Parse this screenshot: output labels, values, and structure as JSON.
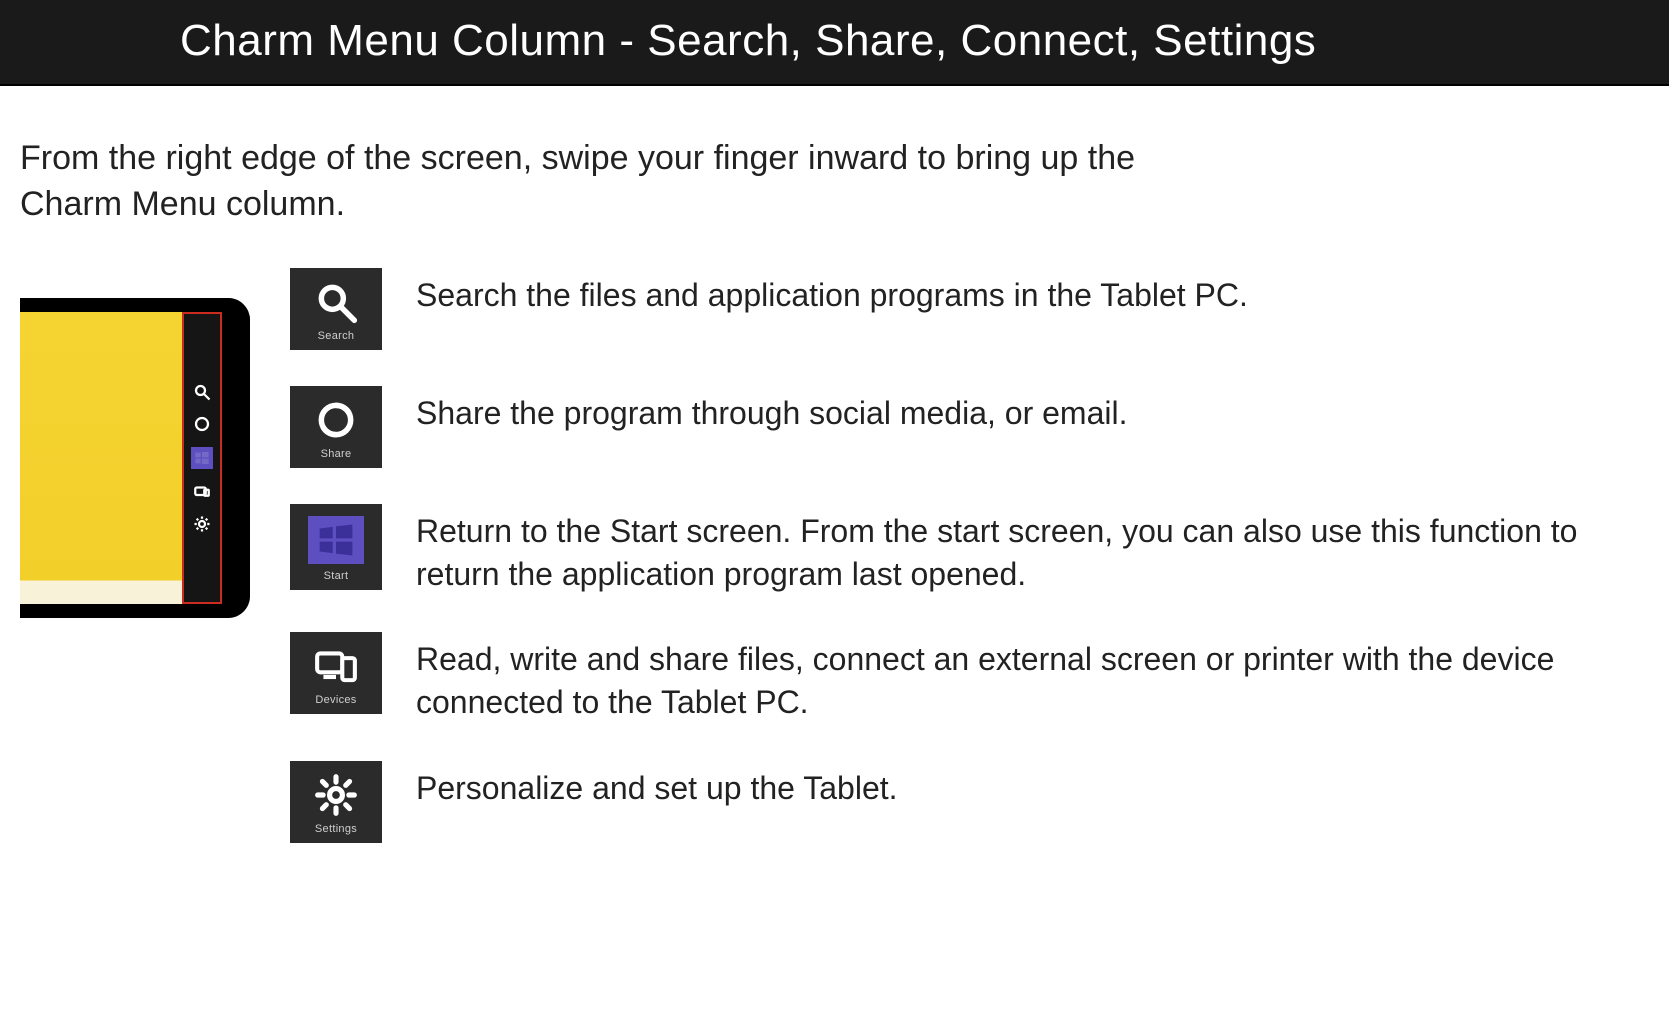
{
  "header": {
    "title": "Charm Menu Column - Search, Share, Connect, Settings"
  },
  "intro": "From the right edge of the screen, swipe your finger inward to bring up the Charm Menu column.",
  "charms": [
    {
      "icon": "search",
      "label": "Search",
      "description": "Search the files and application programs in the Tablet PC."
    },
    {
      "icon": "share",
      "label": "Share",
      "description": "Share the program through social media, or email."
    },
    {
      "icon": "start",
      "label": "Start",
      "description": "Return to the Start screen. From the start screen, you can also use this function to return the application program last opened."
    },
    {
      "icon": "devices",
      "label": "Devices",
      "description": "Read, write and share files, connect an external screen or printer with the device connected to the Tablet PC."
    },
    {
      "icon": "settings",
      "label": "Settings",
      "description": "Personalize and set up the Tablet."
    }
  ]
}
